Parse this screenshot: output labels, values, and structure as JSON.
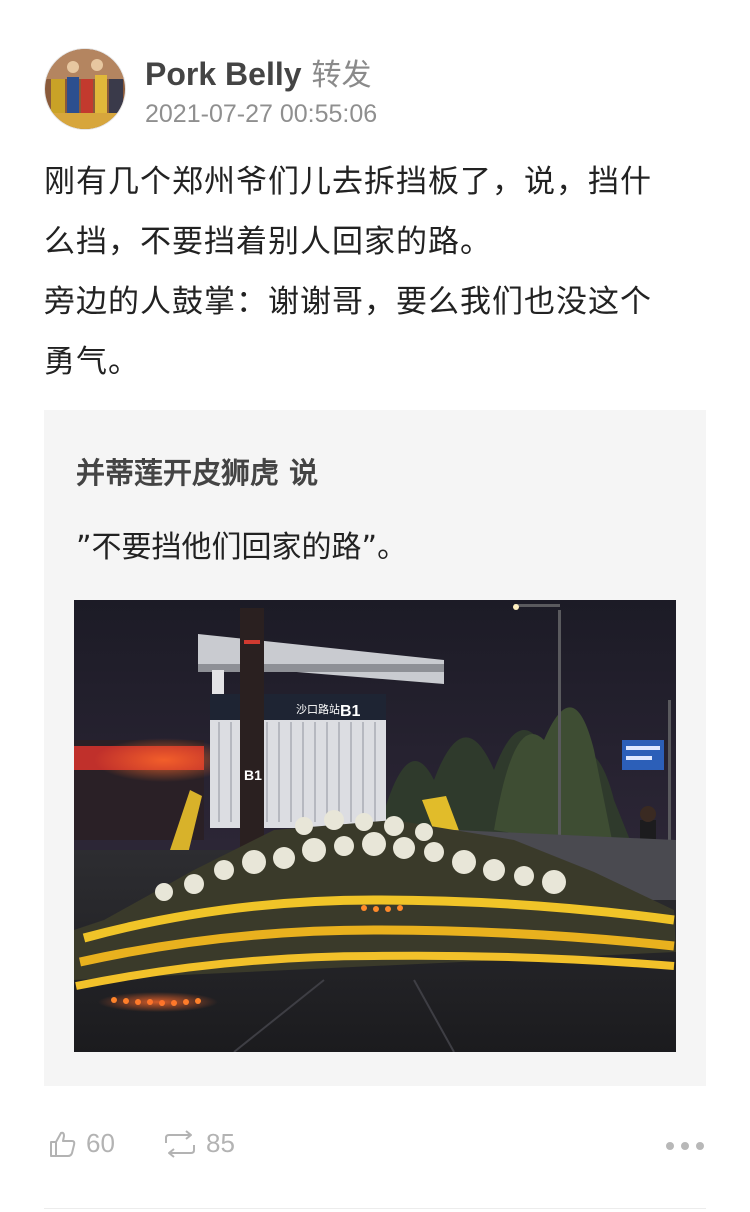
{
  "post": {
    "username": "Pork Belly",
    "action": "转发",
    "timestamp": "2021-07-27 00:55:06",
    "text_lines": [
      "刚有几个郑州爷们儿去拆挡板了，说，挡什",
      "么挡，不要挡着别人回家的路。",
      "旁边的人鼓掌：谢谢哥，要么我们也没这个",
      "勇气。"
    ]
  },
  "repost": {
    "author_line": "并蒂莲开皮狮虎 说",
    "text": "”不要挡他们回家的路”。",
    "photo_signs": {
      "station_name": "沙口路站",
      "entrance": "B1",
      "entrance_vertical": "B1"
    }
  },
  "actions": {
    "like_count": "60",
    "repost_count": "85"
  },
  "icons": {
    "like": "thumbs-up-icon",
    "repost": "repost-arrows-icon",
    "more": "more-dots-icon"
  },
  "colors": {
    "username": "#444444",
    "secondary_text": "#8f8f8f",
    "repost_background": "#f5f5f5",
    "icon_gray": "#b3b3b3"
  }
}
